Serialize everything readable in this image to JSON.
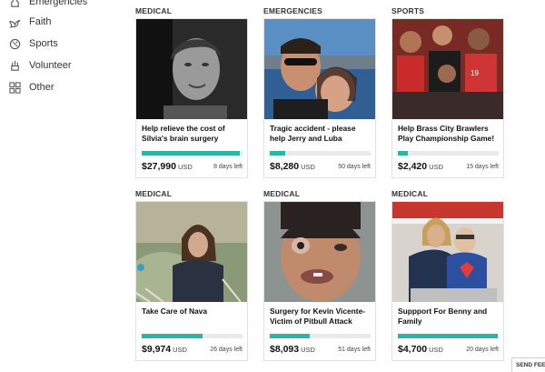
{
  "sidebar": {
    "items": [
      {
        "label": "Emergencies",
        "icon": "emergency-icon"
      },
      {
        "label": "Faith",
        "icon": "dove-icon"
      },
      {
        "label": "Sports",
        "icon": "ball-icon"
      },
      {
        "label": "Volunteer",
        "icon": "volunteer-icon"
      },
      {
        "label": "Other",
        "icon": "grid-icon"
      }
    ]
  },
  "campaigns": [
    {
      "category": "MEDICAL",
      "title": "Help relieve the cost of Silvia's brain surgery",
      "amount": "$27,990",
      "currency": "USD",
      "days_left": "8 days left",
      "progress": 0.97
    },
    {
      "category": "EMERGENCIES",
      "title": "Tragic accident - please help Jerry and Luba",
      "amount": "$8,280",
      "currency": "USD",
      "days_left": "50 days left",
      "progress": 0.15
    },
    {
      "category": "SPORTS",
      "title": "Help Brass City Brawlers Play Championship Game!",
      "amount": "$2,420",
      "currency": "USD",
      "days_left": "15 days left",
      "progress": 0.1
    },
    {
      "category": "MEDICAL",
      "title": "Take Care of Nava",
      "amount": "$9,974",
      "currency": "USD",
      "days_left": "26 days left",
      "progress": 0.6
    },
    {
      "category": "MEDICAL",
      "title": "Surgery for Kevin Vicente- Victim of Pitbull Attack",
      "amount": "$8,093",
      "currency": "USD",
      "days_left": "51 days left",
      "progress": 0.4
    },
    {
      "category": "MEDICAL",
      "title": "Suppport For Benny and Family",
      "amount": "$4,700",
      "currency": "USD",
      "days_left": "20 days left",
      "progress": 0.99
    }
  ],
  "feedback": {
    "label": "SEND FEEDBACK"
  },
  "colors": {
    "accent": "#2bb5aa",
    "track": "#eaeaea"
  }
}
